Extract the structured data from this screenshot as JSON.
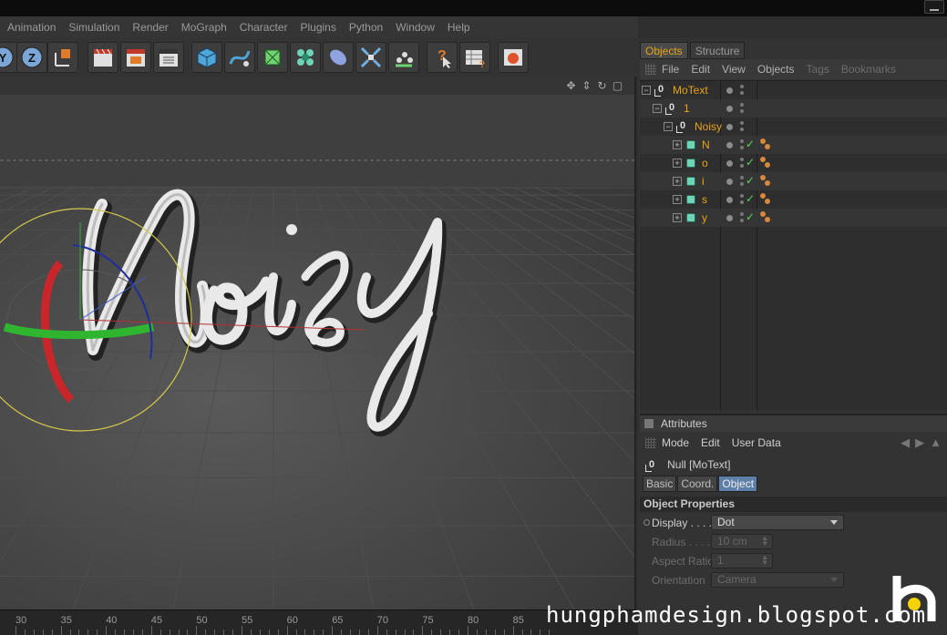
{
  "menubar": {
    "items": [
      "Animation",
      "Simulation",
      "Render",
      "MoGraph",
      "Character",
      "Plugins",
      "Python",
      "Window",
      "Help"
    ]
  },
  "toolbar": {
    "icons": [
      "y-axis-icon",
      "z-axis-icon",
      "coordinate-system-icon",
      "render-view-icon",
      "render-picture-viewer-icon",
      "render-settings-icon",
      "cube-primitive-icon",
      "spline-pen-icon",
      "nurbs-icon",
      "mograph-cloner-icon",
      "deformer-icon",
      "scene-icon",
      "environment-icon",
      "help-cursor-icon",
      "layer-icon",
      "content-browser-icon"
    ]
  },
  "viewport": {
    "scene_text": "Noisy",
    "timeline_ticks": [
      "30",
      "35",
      "40",
      "45",
      "50",
      "55",
      "60",
      "65",
      "70",
      "75",
      "80",
      "85"
    ]
  },
  "tabs": [
    {
      "label": "Objects",
      "active": true
    },
    {
      "label": "Structure",
      "active": false
    }
  ],
  "object_manager": {
    "menu": [
      {
        "label": "File",
        "dim": false
      },
      {
        "label": "Edit",
        "dim": false
      },
      {
        "label": "View",
        "dim": false
      },
      {
        "label": "Objects",
        "dim": false
      },
      {
        "label": "Tags",
        "dim": true
      },
      {
        "label": "Bookmarks",
        "dim": true
      }
    ],
    "rows": [
      {
        "name": "MoText",
        "depth": 0,
        "type": "null",
        "expander": "−"
      },
      {
        "name": "1",
        "depth": 1,
        "type": "null",
        "expander": "−"
      },
      {
        "name": "Noisy",
        "depth": 2,
        "type": "null",
        "expander": "−"
      },
      {
        "name": "N",
        "depth": 3,
        "type": "cube",
        "expander": "+"
      },
      {
        "name": "o",
        "depth": 3,
        "type": "cube",
        "expander": "+"
      },
      {
        "name": "i",
        "depth": 3,
        "type": "cube",
        "expander": "+"
      },
      {
        "name": "s",
        "depth": 3,
        "type": "cube",
        "expander": "+"
      },
      {
        "name": "y",
        "depth": 3,
        "type": "cube",
        "expander": "+"
      }
    ],
    "check_glyph": "✓"
  },
  "attributes": {
    "title": "Attributes",
    "menu": [
      "Mode",
      "Edit",
      "User Data"
    ],
    "object_label": "Null [MoText]",
    "tabs": [
      {
        "label": "Basic",
        "active": false
      },
      {
        "label": "Coord.",
        "active": false
      },
      {
        "label": "Object",
        "active": true
      }
    ],
    "section": "Object Properties",
    "props": {
      "display": {
        "label": "Display . . . .",
        "value": "Dot"
      },
      "radius": {
        "label": "Radius . . . .",
        "value": "10 cm"
      },
      "aspect": {
        "label": "Aspect Ratio",
        "value": "1"
      },
      "orientation": {
        "label": "Orientation",
        "value": "Camera"
      }
    }
  },
  "watermark": "hungphamdesign.blogspot.com",
  "colors": {
    "accent_orange": "#e8a317",
    "active_tab_blue": "#5e7fa8",
    "check_green": "#5fd35f"
  }
}
